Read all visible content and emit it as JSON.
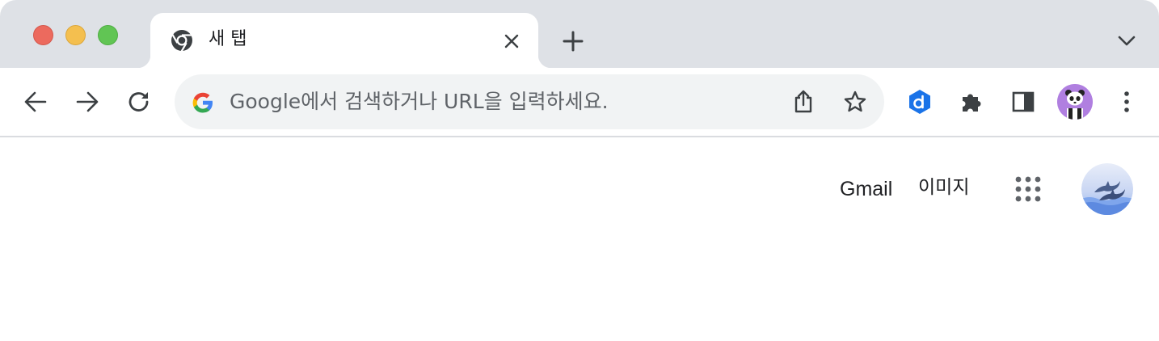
{
  "tab": {
    "title": "새 탭"
  },
  "omnibox": {
    "placeholder": "Google에서 검색하거나 URL을 입력하세요."
  },
  "page": {
    "gmail": "Gmail",
    "images": "이미지"
  },
  "colors": {
    "tabstrip": "#dee1e6",
    "omnibox": "#f1f3f4",
    "profile": "#b07fe0",
    "ext_blue": "#1a73e8"
  },
  "icons": [
    "chrome-icon",
    "close-icon",
    "plus-icon",
    "chevron-down-icon",
    "back-arrow-icon",
    "forward-arrow-icon",
    "reload-icon",
    "google-g-icon",
    "share-icon",
    "star-icon",
    "d-extension-icon",
    "puzzle-icon",
    "side-panel-icon",
    "panda-avatar-icon",
    "kebab-menu-icon",
    "apps-grid-icon",
    "dolphin-avatar-icon"
  ]
}
